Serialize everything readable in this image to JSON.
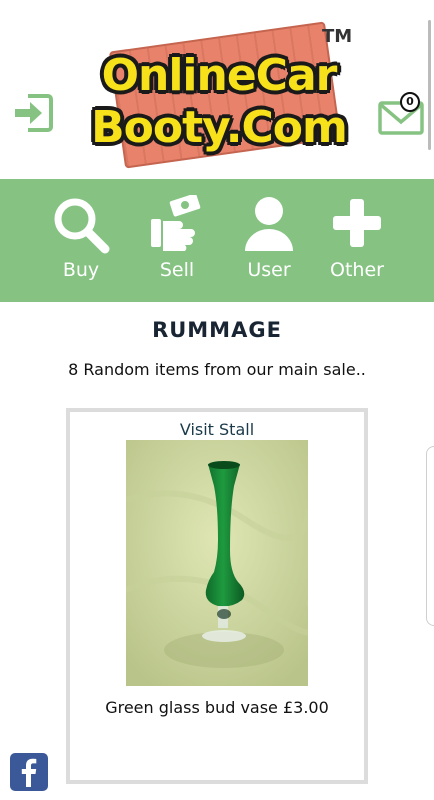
{
  "header": {
    "logo_line1": "OnlineCar",
    "logo_line2": "Booty.Com",
    "logo_tm": "TM",
    "mail_count": "0"
  },
  "nav": {
    "items": [
      {
        "label": "Buy",
        "icon": "search-icon"
      },
      {
        "label": "Sell",
        "icon": "hand-money-icon"
      },
      {
        "label": "User",
        "icon": "user-icon"
      },
      {
        "label": "Other",
        "icon": "plus-icon"
      }
    ]
  },
  "main": {
    "title": "RUMMAGE",
    "subtitle": "8 Random items from our main sale..",
    "item": {
      "visit_label": "Visit Stall",
      "caption": "Green glass bud vase £3.00"
    }
  },
  "colors": {
    "nav_bg": "#86c383",
    "icon_green": "#86c383",
    "facebook": "#3b5998"
  }
}
